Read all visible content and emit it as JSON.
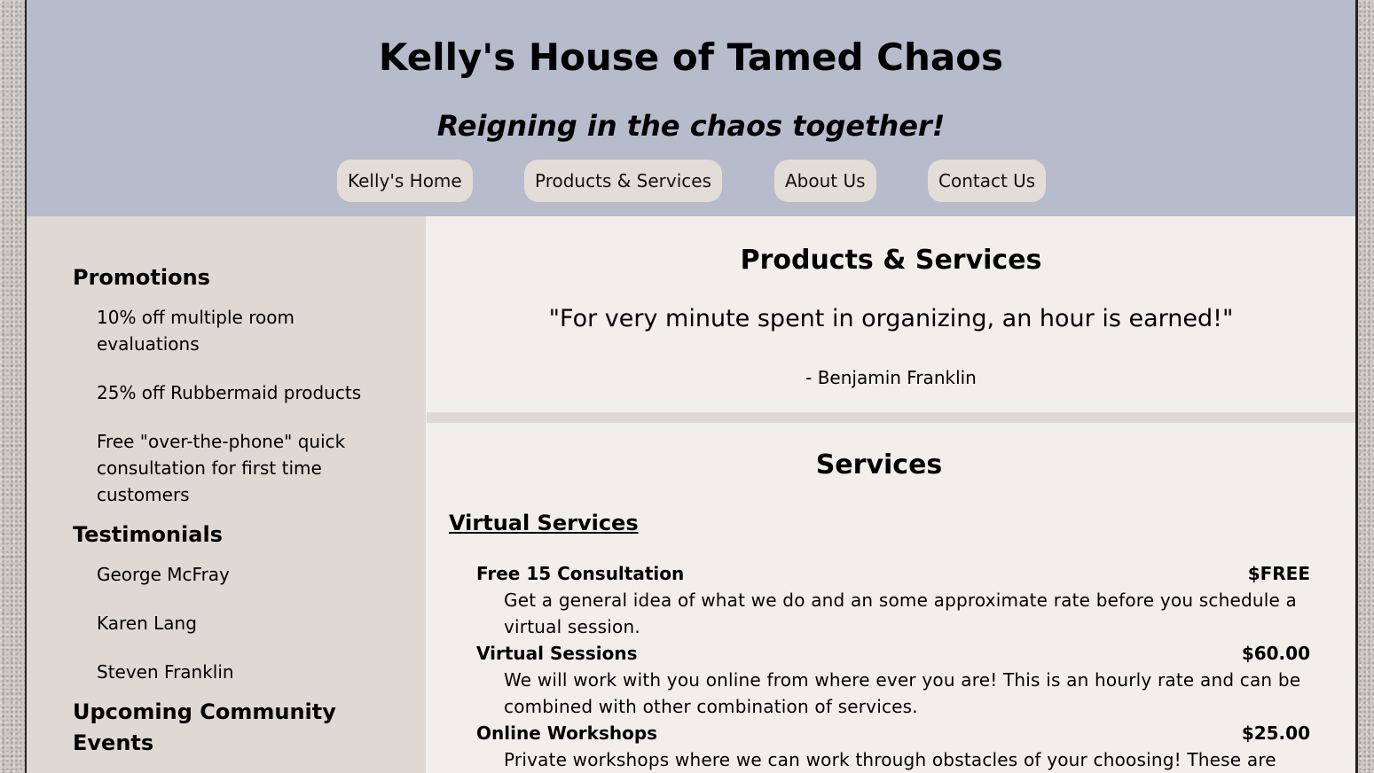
{
  "header": {
    "title": "Kelly's House of Tamed Chaos",
    "tagline": "Reigning in the chaos together!"
  },
  "nav": {
    "items": [
      {
        "label": "Kelly's Home"
      },
      {
        "label": "Products & Services"
      },
      {
        "label": "About Us"
      },
      {
        "label": "Contact Us"
      }
    ]
  },
  "sidebar": {
    "promotions": {
      "heading": "Promotions",
      "items": [
        "10% off multiple room evaluations",
        "25% off Rubbermaid products",
        "Free \"over-the-phone\" quick consultation for first time customers"
      ]
    },
    "testimonials": {
      "heading": "Testimonials",
      "items": [
        "George McFray",
        "Karen Lang",
        "Steven Franklin"
      ]
    },
    "events": {
      "heading": "Upcoming Community Events"
    }
  },
  "main": {
    "heading": "Products & Services",
    "quote": "\"For very minute spent in organizing, an hour is earned!\"",
    "quote_author": "- Benjamin Franklin",
    "services": {
      "heading": "Services",
      "subheading": "Virtual Services",
      "items": [
        {
          "name": "Free 15 Consultation",
          "price": "$FREE",
          "desc": "Get a general idea of what we do and an some approximate rate before you schedule a virtual session."
        },
        {
          "name": "Virtual Sessions",
          "price": "$60.00",
          "desc": "We will work with you online from where ever you are! This is an hourly rate and can be combined with other combination of services."
        },
        {
          "name": "Online Workshops",
          "price": "$25.00",
          "desc": "Private workshops where we can work through obstacles of your choosing! These are"
        }
      ]
    }
  }
}
